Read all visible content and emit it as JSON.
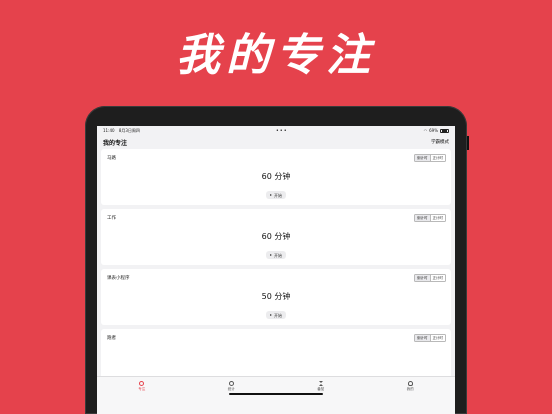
{
  "headline": "我的专注",
  "status_bar": {
    "time": "11:40",
    "date": "8月3日周四",
    "dots": "•••",
    "battery": "69%"
  },
  "nav": {
    "title": "我的专注",
    "action": "学霸模式"
  },
  "tasks": [
    {
      "name": "马路",
      "time": "60 分钟",
      "mode_down": "倒计时",
      "mode_up": "正计时",
      "start": "开始"
    },
    {
      "name": "工作",
      "time": "60 分钟",
      "mode_down": "倒计时",
      "mode_up": "正计时",
      "start": "开始"
    },
    {
      "name": "课表小程序",
      "time": "50 分钟",
      "mode_down": "倒计时",
      "mode_up": "正计时",
      "start": "开始"
    },
    {
      "name": "跑者",
      "mode_down": "倒计时",
      "mode_up": "正计时"
    }
  ],
  "tabs": [
    {
      "label": "专注",
      "icon": "timer-icon"
    },
    {
      "label": "统计",
      "icon": "chart-icon"
    },
    {
      "label": "番茄",
      "icon": "hourglass-icon"
    },
    {
      "label": "我的",
      "icon": "person-icon"
    }
  ],
  "colors": {
    "brand": "#e5424c",
    "screen_bg": "#f2f2f4",
    "card_bg": "#ffffff"
  }
}
